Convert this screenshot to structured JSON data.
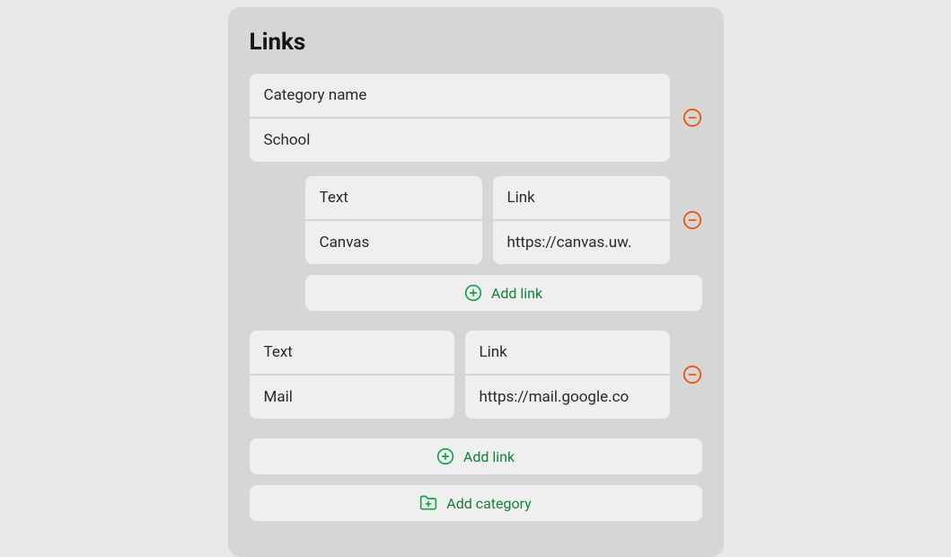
{
  "title": "Links",
  "labels": {
    "category_name": "Category name",
    "text": "Text",
    "link": "Link",
    "add_link": "Add link",
    "add_category": "Add category"
  },
  "category": {
    "name": "School",
    "links": [
      {
        "text": "Canvas",
        "link": "https://canvas.uw."
      }
    ]
  },
  "orphan_links": [
    {
      "text": "Mail",
      "link": "https://mail.google.co"
    }
  ]
}
